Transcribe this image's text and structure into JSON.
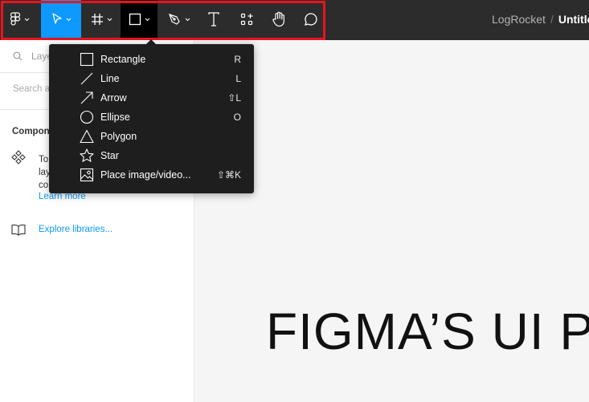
{
  "header": {
    "team": "LogRocket",
    "separator": "/",
    "file": "Untitled"
  },
  "sidebar": {
    "search_label": "Layers",
    "search_placeholder": "Search assets",
    "components_heading": "Components",
    "info_lines": [
      "To",
      "lay",
      "co"
    ],
    "learn_more": "Learn more",
    "explore": "Explore libraries..."
  },
  "canvas": {
    "title": "FIGMA’S UI PRO"
  },
  "menu": {
    "items": [
      {
        "label": "Rectangle",
        "shortcut": "R",
        "icon": "rectangle-icon"
      },
      {
        "label": "Line",
        "shortcut": "L",
        "icon": "line-icon"
      },
      {
        "label": "Arrow",
        "shortcut": "⇧L",
        "icon": "arrow-icon"
      },
      {
        "label": "Ellipse",
        "shortcut": "O",
        "icon": "ellipse-icon"
      },
      {
        "label": "Polygon",
        "shortcut": "",
        "icon": "polygon-icon"
      },
      {
        "label": "Star",
        "shortcut": "",
        "icon": "star-icon"
      },
      {
        "label": "Place image/video...",
        "shortcut": "⇧⌘K",
        "icon": "image-icon"
      }
    ]
  },
  "colors": {
    "toolbar_bg": "#2c2c2c",
    "active_blue": "#0d99ff",
    "highlight_red": "#e8141e",
    "link_blue": "#0d99ff"
  }
}
